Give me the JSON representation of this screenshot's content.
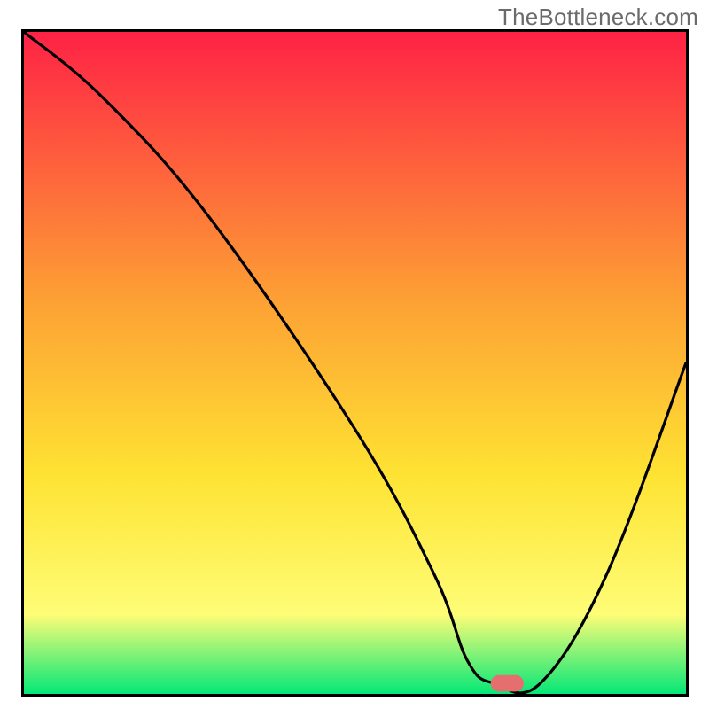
{
  "watermark": "TheBottleneck.com",
  "colors": {
    "gradient_top": "#fe2245",
    "gradient_upper_mid": "#fd9f34",
    "gradient_mid": "#fee333",
    "gradient_low": "#fefd77",
    "gradient_bottom": "#04e777",
    "axis": "#000000",
    "line": "#000000",
    "marker_fill": "#e46f6e",
    "marker_stroke": "#e46f6e"
  },
  "chart_data": {
    "type": "line",
    "title": "",
    "xlabel": "",
    "ylabel": "",
    "xlim": [
      0,
      100
    ],
    "ylim": [
      0,
      100
    ],
    "grid": false,
    "legend": false,
    "series": [
      {
        "name": "bottleneck-curve",
        "x": [
          0,
          12,
          28,
          50,
          62,
          67,
          71,
          78,
          88,
          100
        ],
        "y": [
          100,
          90,
          72,
          40,
          18,
          5,
          1.6,
          1.6,
          18,
          50
        ]
      }
    ],
    "marker": {
      "name": "optimal-point",
      "x": 73,
      "y": 1.6,
      "shape": "rounded-rect",
      "width": 5,
      "height": 2.5
    }
  }
}
